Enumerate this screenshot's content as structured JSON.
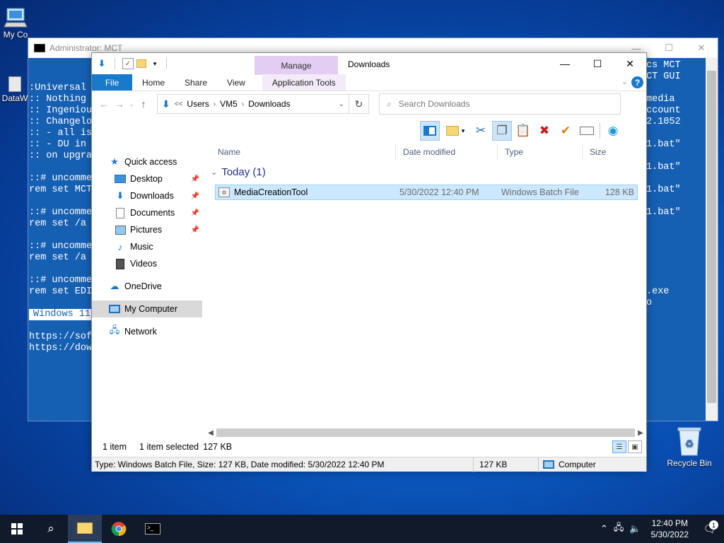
{
  "desktop": {
    "icons": [
      {
        "label": "My Co"
      },
      {
        "label": "DataW"
      },
      {
        "label": "Recycle Bin"
      }
    ]
  },
  "cmd": {
    "title": "Administrator: MCT",
    "lines": [
      ":Universal",
      ":: Nothing",
      ":: Ingeniou",
      ":: Changelo",
      ":: - all is",
      ":: - DU in ",
      ":: on upgra",
      "",
      "::# uncomme",
      "rem set MCT",
      "",
      "::# uncomme",
      "rem set /a ",
      "",
      "::# uncomme",
      "rem set /a ",
      "",
      "::# uncomme",
      "rem set EDI"
    ],
    "right_lines": [
      "cs MCT",
      "CT GUI",
      "",
      "media",
      "ccount",
      "2.1052",
      "",
      "1.bat\"",
      "",
      "1.bat\"",
      "",
      "1.bat\"",
      "",
      "1.bat\""
    ],
    "highlight": "Windows 11",
    "url_lines": [
      "https://sof",
      "https://dow"
    ],
    "url_right": [
      ".exe",
      "o"
    ]
  },
  "explorer": {
    "manage_label": "Manage",
    "title": "Downloads",
    "tabs": {
      "file": "File",
      "home": "Home",
      "share": "Share",
      "view": "View",
      "app_tools": "Application Tools"
    },
    "help": "?",
    "address": {
      "overflow": "<<",
      "crumbs": [
        "Users",
        "VM5",
        "Downloads"
      ]
    },
    "search_placeholder": "Search Downloads",
    "nav": {
      "quick_access": "Quick access",
      "desktop": "Desktop",
      "downloads": "Downloads",
      "documents": "Documents",
      "pictures": "Pictures",
      "music": "Music",
      "videos": "Videos",
      "onedrive": "OneDrive",
      "my_computer": "My Computer",
      "network": "Network"
    },
    "columns": {
      "name": "Name",
      "date": "Date modified",
      "type": "Type",
      "size": "Size"
    },
    "group": "Today (1)",
    "files": [
      {
        "name": "MediaCreationTool",
        "date": "5/30/2022 12:40 PM",
        "type": "Windows Batch File",
        "size": "128 KB"
      }
    ],
    "status": {
      "count": "1 item",
      "selected": "1 item selected",
      "size": "127 KB"
    },
    "details": {
      "info": "Type: Windows Batch File, Size: 127 KB, Date modified: 5/30/2022 12:40 PM",
      "size": "127 KB",
      "location": "Computer"
    }
  },
  "taskbar": {
    "time": "12:40 PM",
    "date": "5/30/2022",
    "notifications": "1"
  },
  "colors": {
    "accent": "#1979ca",
    "manage_tab": "#e3cdf2",
    "console_bg": "#1660b4",
    "selection": "#cce8ff"
  }
}
